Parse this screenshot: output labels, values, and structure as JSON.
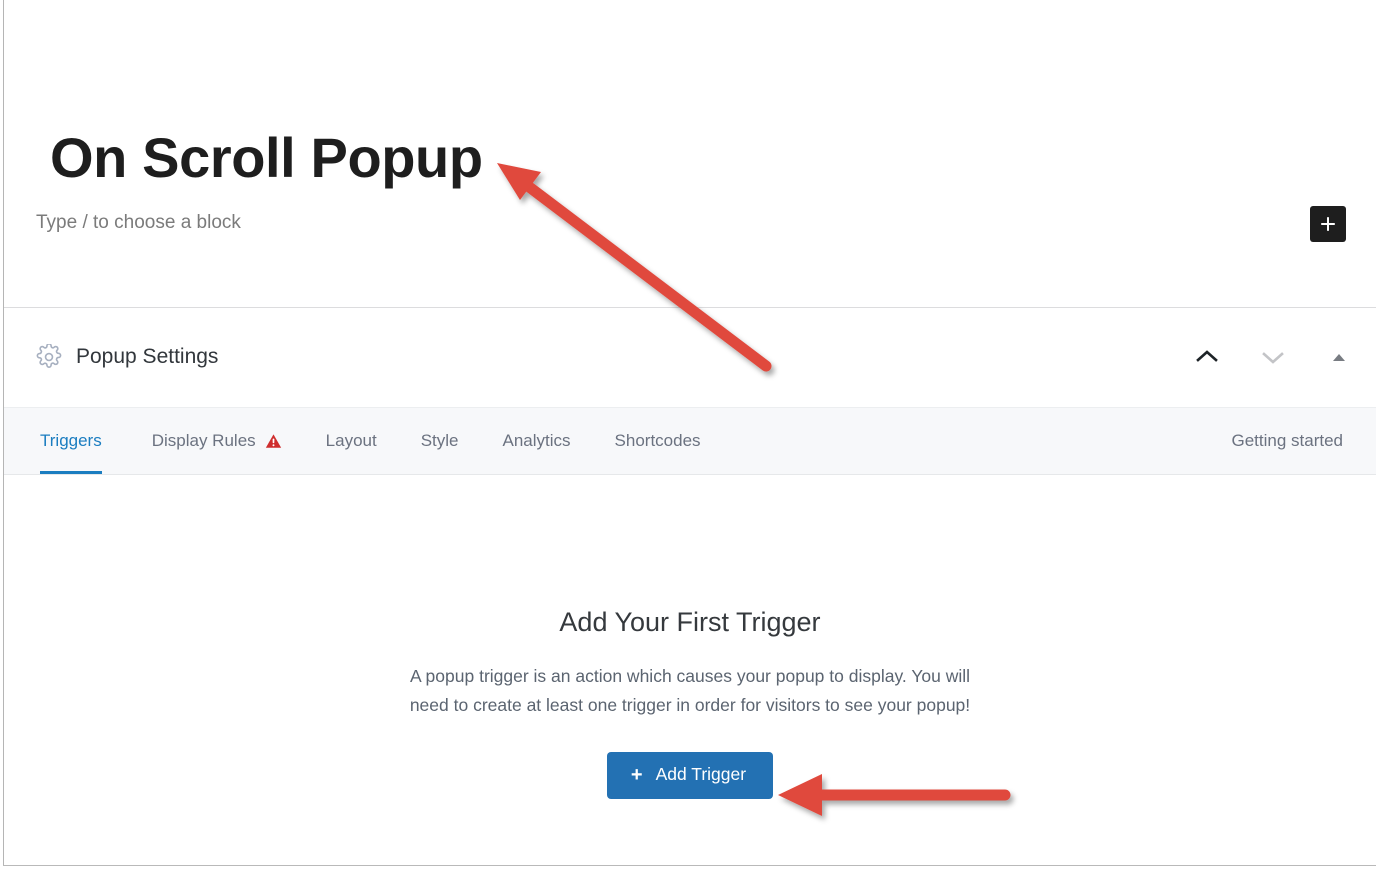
{
  "editor": {
    "post_title": "On Scroll Popup",
    "block_placeholder": "Type / to choose a block",
    "inserter_icon": "plus-icon",
    "inserter_label": "Add block"
  },
  "panel": {
    "icon": "gear-icon",
    "title": "Popup Settings",
    "actions": [
      {
        "name": "move-up-icon",
        "glyph": "chevron-up",
        "color": "#1d2327"
      },
      {
        "name": "move-down-icon",
        "glyph": "chevron-down",
        "color": "#c3c4c7"
      },
      {
        "name": "toggle-panel-icon",
        "glyph": "triangle-up",
        "color": "#787c82"
      }
    ]
  },
  "tabs": {
    "items": [
      {
        "label": "Triggers",
        "active": true,
        "warning": false
      },
      {
        "label": "Display Rules",
        "active": false,
        "warning": true
      },
      {
        "label": "Layout",
        "active": false,
        "warning": false
      },
      {
        "label": "Style",
        "active": false,
        "warning": false
      },
      {
        "label": "Analytics",
        "active": false,
        "warning": false
      },
      {
        "label": "Shortcodes",
        "active": false,
        "warning": false
      }
    ],
    "warning_icon": "warning-triangle-icon",
    "getting_started": "Getting started"
  },
  "empty_state": {
    "title": "Add Your First Trigger",
    "description": "A popup trigger is an action which causes your popup to display. You will need to create at least one trigger in order for visitors to see your popup!",
    "button_label": "Add Trigger",
    "button_icon": "plus-icon"
  },
  "annotations": [
    {
      "name": "arrow-to-title",
      "target": "post-title"
    },
    {
      "name": "arrow-to-add-trigger-button",
      "target": "add-trigger-button"
    }
  ],
  "colors": {
    "accent_blue": "#2371b3",
    "tab_active_blue": "#1b7dc0",
    "warning_red": "#d63638",
    "annotation_red": "#e0483c",
    "text_dark": "#1e1e1e",
    "text_muted": "#6b7280",
    "tab_bar_bg": "#f7f8fa"
  }
}
